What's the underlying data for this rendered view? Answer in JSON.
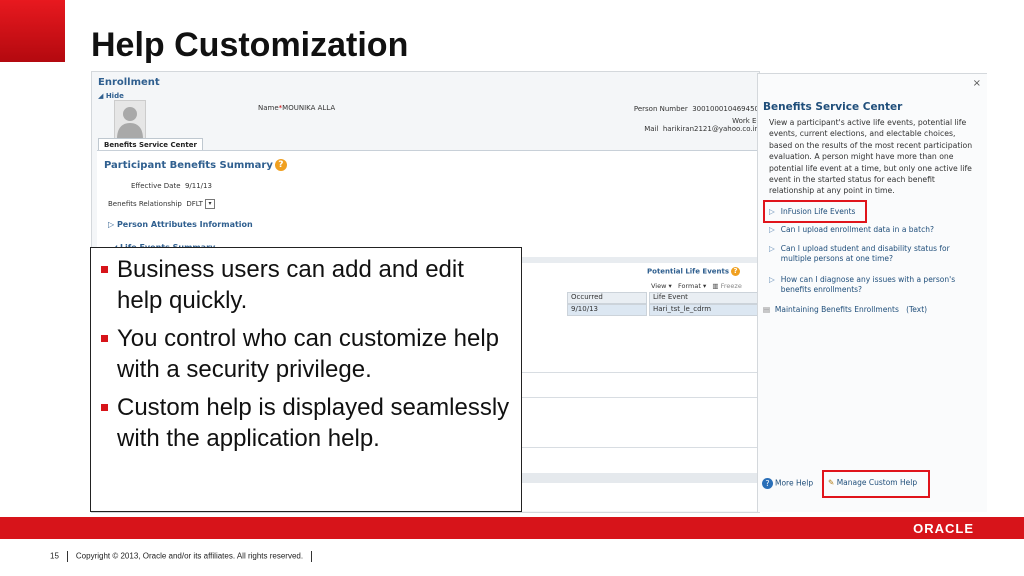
{
  "slide": {
    "title": "Help Customization",
    "bullets": [
      "Business users can add and edit help quickly.",
      "You control who can customize help with a security privilege.",
      "Custom help is displayed seamlessly with the application help."
    ],
    "page_number": "15",
    "copyright": "Copyright © 2013, Oracle and/or its affiliates. All rights reserved.",
    "logo": "ORACLE",
    "accent_color": "#d7141a"
  },
  "app": {
    "title": "Enrollment",
    "hide_label": "Hide",
    "name_label": "Name",
    "name_value": "MOUNIKA ALLA",
    "person_number_label": "Person Number",
    "person_number_value": "300100010469450",
    "work_email_label": "Work E-Mail",
    "work_email_value": "harikiran2121@yahoo.co.in",
    "tab_label": "Benefits Service Center",
    "section_title": "Participant Benefits Summary",
    "effective_date_label": "Effective Date",
    "effective_date_value": "9/11/13",
    "benefits_relationship_label": "Benefits Relationship",
    "benefits_relationship_value": "DFLT",
    "person_attributes": "Person Attributes Information",
    "life_events_summary": "Life Events Summary",
    "occurred_header": "Occurred",
    "occurred_value": "9/10/13",
    "potential_life_events": "Potential Life Events",
    "view_label": "View",
    "format_label": "Format",
    "freeze_label": "Freeze",
    "life_event_header": "Life Event",
    "life_event_value": "Hari_tst_le_cdrm"
  },
  "help_panel": {
    "title": "Benefits Service Center",
    "description": "View a participant's active life events, potential life events, current elections, and electable choices, based on the results of the most recent participation evaluation. A person might have more than one potential life event at a time, but only one active life event in the started status for each benefit relationship at any point in time.",
    "items": [
      "InFusion Life Events",
      "Can I upload enrollment data in a batch?",
      "Can I upload student and disability status for multiple persons at one time?",
      "How can I diagnose any issues with a person's benefits enrollments?"
    ],
    "maintaining_link": "Maintaining Benefits Enrollments",
    "maintaining_type": "(Text)",
    "more_help": "More Help",
    "manage_custom_help": "Manage Custom Help",
    "close_symbol": "×",
    "highlight_color": "#e0141b"
  }
}
